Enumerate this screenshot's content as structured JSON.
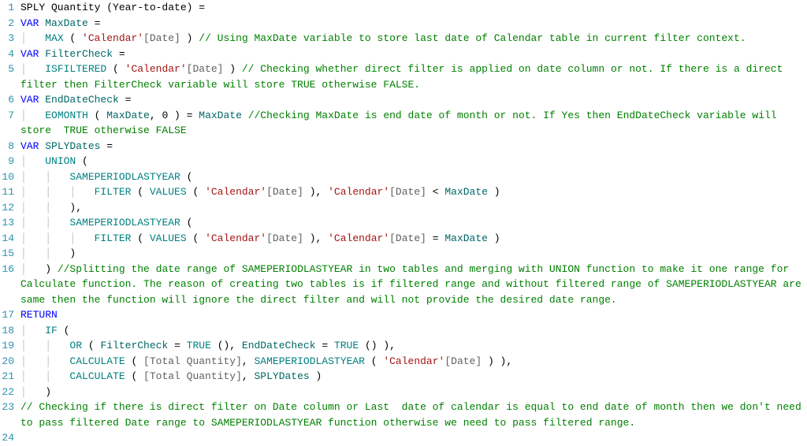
{
  "code": {
    "lines": [
      {
        "num": 1,
        "segs": [
          {
            "c": "plain",
            "t": "SPLY Quantity (Year-to-date) ="
          }
        ]
      },
      {
        "num": 2,
        "segs": [
          {
            "c": "kw",
            "t": "VAR"
          },
          {
            "c": "plain",
            "t": " "
          },
          {
            "c": "ident",
            "t": "MaxDate"
          },
          {
            "c": "plain",
            "t": " ="
          }
        ]
      },
      {
        "num": 3,
        "segs": [
          {
            "c": "plain",
            "t": "    "
          },
          {
            "c": "fn",
            "t": "MAX"
          },
          {
            "c": "plain",
            "t": " ( "
          },
          {
            "c": "str",
            "t": "'Calendar'"
          },
          {
            "c": "brack",
            "t": "[Date]"
          },
          {
            "c": "plain",
            "t": " ) "
          },
          {
            "c": "comment",
            "t": "// Using MaxDate variable to store last date of Calendar table in current filter context."
          }
        ]
      },
      {
        "num": 4,
        "segs": [
          {
            "c": "kw",
            "t": "VAR"
          },
          {
            "c": "plain",
            "t": " "
          },
          {
            "c": "ident",
            "t": "FilterCheck"
          },
          {
            "c": "plain",
            "t": " ="
          }
        ]
      },
      {
        "num": 5,
        "segs": [
          {
            "c": "plain",
            "t": "    "
          },
          {
            "c": "fn",
            "t": "ISFILTERED"
          },
          {
            "c": "plain",
            "t": " ( "
          },
          {
            "c": "str",
            "t": "'Calendar'"
          },
          {
            "c": "brack",
            "t": "[Date]"
          },
          {
            "c": "plain",
            "t": " ) "
          },
          {
            "c": "comment",
            "t": "// Checking whether direct filter is applied on date column or not. If there is a direct filter then FilterCheck variable will store TRUE otherwise FALSE."
          }
        ]
      },
      {
        "num": 6,
        "segs": [
          {
            "c": "kw",
            "t": "VAR"
          },
          {
            "c": "plain",
            "t": " "
          },
          {
            "c": "ident",
            "t": "EndDateCheck"
          },
          {
            "c": "plain",
            "t": " ="
          }
        ]
      },
      {
        "num": 7,
        "segs": [
          {
            "c": "plain",
            "t": "    "
          },
          {
            "c": "fn",
            "t": "EOMONTH"
          },
          {
            "c": "plain",
            "t": " ( "
          },
          {
            "c": "ident",
            "t": "MaxDate"
          },
          {
            "c": "plain",
            "t": ", 0 ) = "
          },
          {
            "c": "ident",
            "t": "MaxDate"
          },
          {
            "c": "plain",
            "t": " "
          },
          {
            "c": "comment",
            "t": "//Checking MaxDate is end date of month or not. If Yes then EndDateCheck variable will store  TRUE otherwise FALSE"
          }
        ]
      },
      {
        "num": 8,
        "segs": [
          {
            "c": "kw",
            "t": "VAR"
          },
          {
            "c": "plain",
            "t": " "
          },
          {
            "c": "ident",
            "t": "SPLYDates"
          },
          {
            "c": "plain",
            "t": " ="
          }
        ]
      },
      {
        "num": 9,
        "segs": [
          {
            "c": "plain",
            "t": "    "
          },
          {
            "c": "fn",
            "t": "UNION"
          },
          {
            "c": "plain",
            "t": " ("
          }
        ]
      },
      {
        "num": 10,
        "segs": [
          {
            "c": "plain",
            "t": "        "
          },
          {
            "c": "fn",
            "t": "SAMEPERIODLASTYEAR"
          },
          {
            "c": "plain",
            "t": " ("
          }
        ]
      },
      {
        "num": 11,
        "segs": [
          {
            "c": "plain",
            "t": "            "
          },
          {
            "c": "fn",
            "t": "FILTER"
          },
          {
            "c": "plain",
            "t": " ( "
          },
          {
            "c": "fn",
            "t": "VALUES"
          },
          {
            "c": "plain",
            "t": " ( "
          },
          {
            "c": "str",
            "t": "'Calendar'"
          },
          {
            "c": "brack",
            "t": "[Date]"
          },
          {
            "c": "plain",
            "t": " ), "
          },
          {
            "c": "str",
            "t": "'Calendar'"
          },
          {
            "c": "brack",
            "t": "[Date]"
          },
          {
            "c": "plain",
            "t": " < "
          },
          {
            "c": "ident",
            "t": "MaxDate"
          },
          {
            "c": "plain",
            "t": " )"
          }
        ]
      },
      {
        "num": 12,
        "segs": [
          {
            "c": "plain",
            "t": "        ),"
          }
        ]
      },
      {
        "num": 13,
        "segs": [
          {
            "c": "plain",
            "t": "        "
          },
          {
            "c": "fn",
            "t": "SAMEPERIODLASTYEAR"
          },
          {
            "c": "plain",
            "t": " ("
          }
        ]
      },
      {
        "num": 14,
        "segs": [
          {
            "c": "plain",
            "t": "            "
          },
          {
            "c": "fn",
            "t": "FILTER"
          },
          {
            "c": "plain",
            "t": " ( "
          },
          {
            "c": "fn",
            "t": "VALUES"
          },
          {
            "c": "plain",
            "t": " ( "
          },
          {
            "c": "str",
            "t": "'Calendar'"
          },
          {
            "c": "brack",
            "t": "[Date]"
          },
          {
            "c": "plain",
            "t": " ), "
          },
          {
            "c": "str",
            "t": "'Calendar'"
          },
          {
            "c": "brack",
            "t": "[Date]"
          },
          {
            "c": "plain",
            "t": " = "
          },
          {
            "c": "ident",
            "t": "MaxDate"
          },
          {
            "c": "plain",
            "t": " )"
          }
        ]
      },
      {
        "num": 15,
        "segs": [
          {
            "c": "plain",
            "t": "        )"
          }
        ]
      },
      {
        "num": 16,
        "segs": [
          {
            "c": "plain",
            "t": "    ) "
          },
          {
            "c": "comment",
            "t": "//Splitting the date range of SAMEPERIODLASTYEAR in two tables and merging with UNION function to make it one range for Calculate function. The reason of creating two tables is if filtered range and without filtered range of SAMEPERIODLASTYEAR are same then the function will ignore the direct filter and will not provide the desired date range."
          }
        ]
      },
      {
        "num": 17,
        "segs": [
          {
            "c": "kw",
            "t": "RETURN"
          }
        ]
      },
      {
        "num": 18,
        "segs": [
          {
            "c": "plain",
            "t": "    "
          },
          {
            "c": "fn",
            "t": "IF"
          },
          {
            "c": "plain",
            "t": " ("
          }
        ]
      },
      {
        "num": 19,
        "segs": [
          {
            "c": "plain",
            "t": "        "
          },
          {
            "c": "fn",
            "t": "OR"
          },
          {
            "c": "plain",
            "t": " ( "
          },
          {
            "c": "ident",
            "t": "FilterCheck"
          },
          {
            "c": "plain",
            "t": " = "
          },
          {
            "c": "fn",
            "t": "TRUE"
          },
          {
            "c": "plain",
            "t": " (), "
          },
          {
            "c": "ident",
            "t": "EndDateCheck"
          },
          {
            "c": "plain",
            "t": " = "
          },
          {
            "c": "fn",
            "t": "TRUE"
          },
          {
            "c": "plain",
            "t": " () ),"
          }
        ]
      },
      {
        "num": 20,
        "segs": [
          {
            "c": "plain",
            "t": "        "
          },
          {
            "c": "fn",
            "t": "CALCULATE"
          },
          {
            "c": "plain",
            "t": " ( "
          },
          {
            "c": "brack",
            "t": "[Total Quantity]"
          },
          {
            "c": "plain",
            "t": ", "
          },
          {
            "c": "fn",
            "t": "SAMEPERIODLASTYEAR"
          },
          {
            "c": "plain",
            "t": " ( "
          },
          {
            "c": "str",
            "t": "'Calendar'"
          },
          {
            "c": "brack",
            "t": "[Date]"
          },
          {
            "c": "plain",
            "t": " ) ),"
          }
        ]
      },
      {
        "num": 21,
        "segs": [
          {
            "c": "plain",
            "t": "        "
          },
          {
            "c": "fn",
            "t": "CALCULATE"
          },
          {
            "c": "plain",
            "t": " ( "
          },
          {
            "c": "brack",
            "t": "[Total Quantity]"
          },
          {
            "c": "plain",
            "t": ", "
          },
          {
            "c": "ident",
            "t": "SPLYDates"
          },
          {
            "c": "plain",
            "t": " )"
          }
        ]
      },
      {
        "num": 22,
        "segs": [
          {
            "c": "plain",
            "t": "    )"
          }
        ]
      },
      {
        "num": 23,
        "segs": [
          {
            "c": "comment",
            "t": "// Checking if there is direct filter on Date column or Last  date of calendar is equal to end date of month then we don't need to pass filtered Date range to SAMEPERIODLASTYEAR function otherwise we need to pass filtered range."
          }
        ]
      },
      {
        "num": 24,
        "segs": [
          {
            "c": "plain",
            "t": ""
          }
        ]
      }
    ]
  }
}
